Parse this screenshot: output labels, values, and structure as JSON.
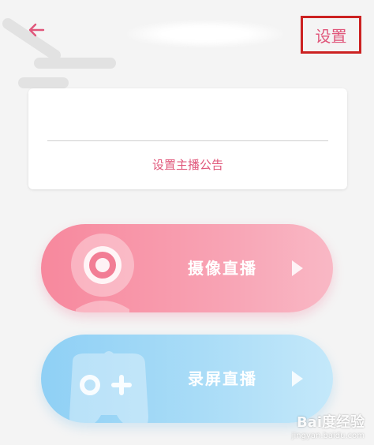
{
  "header": {
    "back_icon": "back-arrow-icon",
    "settings_label": "设置"
  },
  "notice_card": {
    "input_value": "",
    "link_label": "设置主播公告"
  },
  "actions": {
    "camera_live_label": "摄像直播",
    "screen_live_label": "录屏直播"
  },
  "watermark": {
    "brand": "Bai度经验",
    "url": "jingyan.baidu.com"
  },
  "colors": {
    "accent": "#e0567a",
    "highlight_border": "#cc2222",
    "camera_gradient_start": "#f7889d",
    "screen_gradient_start": "#8fd0f5"
  }
}
